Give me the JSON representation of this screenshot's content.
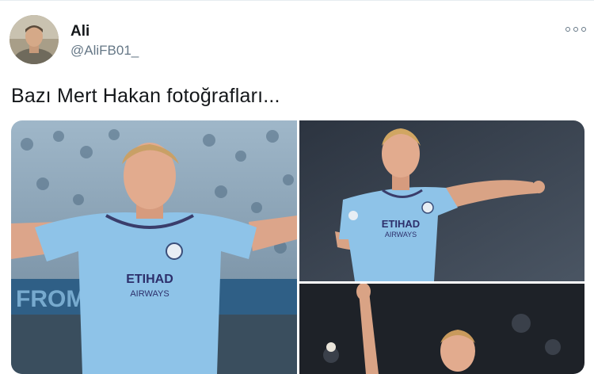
{
  "tweet": {
    "author_name": "Ali",
    "author_handle": "@AliFB01_",
    "text": "Bazı Mert Hakan fotoğrafları...",
    "more_icon": "more-dots-icon"
  },
  "photo1": {
    "sponsor_main": "ETIHAD",
    "sponsor_sub": "AIRWAYS",
    "banner_text": "FROM  & SIS"
  },
  "photo2": {
    "sponsor_main": "ETIHAD",
    "sponsor_sub": "AIRWAYS"
  },
  "colors": {
    "kit_blue": "#8ec3e8",
    "handle_grey": "#657786",
    "text_dark": "#14171a"
  }
}
